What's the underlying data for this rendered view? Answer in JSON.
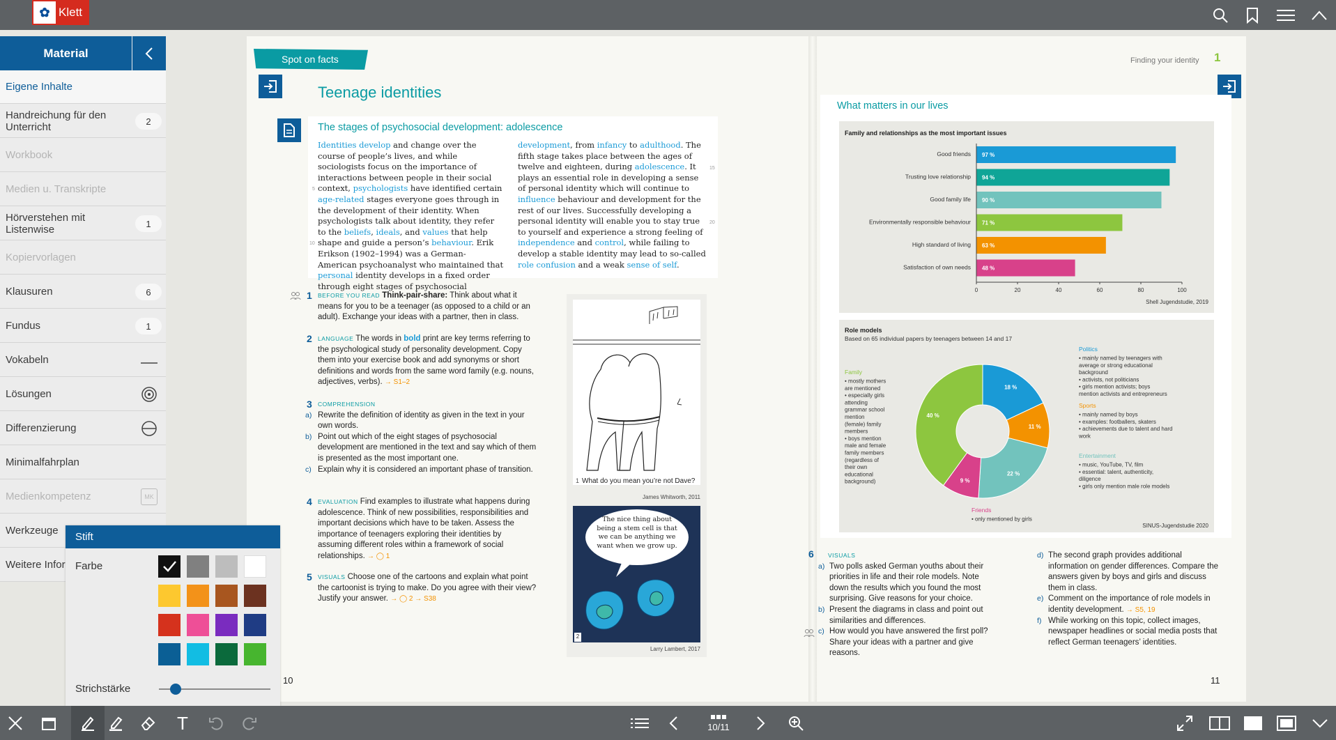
{
  "app": {
    "logo_text": "Klett"
  },
  "sidebar": {
    "title": "Material",
    "items": [
      {
        "label": "Eigene Inhalte",
        "state": "selected"
      },
      {
        "label": "Handreichung für den Unterricht",
        "badge": "2"
      },
      {
        "label": "Workbook",
        "state": "disabled"
      },
      {
        "label": "Medien u. Transkripte",
        "state": "disabled"
      },
      {
        "label": "Hörverstehen mit Listenwise",
        "badge": "1"
      },
      {
        "label": "Kopiervorlagen",
        "state": "disabled"
      },
      {
        "label": "Klausuren",
        "badge": "6"
      },
      {
        "label": "Fundus",
        "badge": "1"
      },
      {
        "label": "Vokabeln",
        "icon": "dash-icon"
      },
      {
        "label": "Lösungen",
        "icon": "target-icon"
      },
      {
        "label": "Differenzierung",
        "icon": "circle-minus-icon"
      },
      {
        "label": "Minimalfahrplan"
      },
      {
        "label": "Medienkompetenz",
        "state": "disabled",
        "icon": "mk-icon",
        "icon_text": "MK"
      },
      {
        "label": "Werkzeuge"
      },
      {
        "label": "Weitere Infor"
      }
    ]
  },
  "pen_panel": {
    "title": "Stift",
    "color_label": "Farbe",
    "stroke_label": "Strichstärke",
    "stroke_level": 0.15,
    "colors": [
      "#111111",
      "#808080",
      "#bdbdbd",
      "#ffffff",
      "#fdc82f",
      "#f39219",
      "#a8561f",
      "#6c3220",
      "#d5321d",
      "#ee4f97",
      "#7a2cbf",
      "#1f3c84",
      "#0b5f95",
      "#12bde3",
      "#0b6a3c",
      "#47b52f"
    ],
    "selected_color_index": 0
  },
  "toolbar": {
    "page_indicator": "10/11"
  },
  "left_page": {
    "banner": "Spot on facts",
    "title": "Teenage identities",
    "box_title": "The stages of psychosocial development: adolescence",
    "col1": [
      {
        "t": "Identities develop",
        "c": "bl"
      },
      {
        "t": " and change over the course of people’s lives, and while sociologists focus on the importance of interactions between people in their social context, "
      },
      {
        "t": "psychologists",
        "c": "bl"
      },
      {
        "t": " have identified certain "
      },
      {
        "t": "age-related",
        "c": "bl"
      },
      {
        "t": " stages everyone goes through in the development of their identity. When psychologists talk about identity, they refer to the "
      },
      {
        "t": "beliefs",
        "c": "bl"
      },
      {
        "t": ", "
      },
      {
        "t": "ideals",
        "c": "bl"
      },
      {
        "t": ", and "
      },
      {
        "t": "values",
        "c": "bl"
      },
      {
        "t": " that help shape and guide a person’s "
      },
      {
        "t": "behaviour",
        "c": "bl"
      },
      {
        "t": ". Erik Erikson (1902–1994) was a German-American psychoanalyst who maintained that "
      },
      {
        "t": "personal",
        "c": "bl"
      },
      {
        "t": " identity develops in a fixed order through eight stages of psychosocial"
      }
    ],
    "col2": [
      {
        "t": "development",
        "c": "bl"
      },
      {
        "t": ", from "
      },
      {
        "t": "infancy",
        "c": "bl"
      },
      {
        "t": " to "
      },
      {
        "t": "adulthood",
        "c": "bl"
      },
      {
        "t": ". The fifth stage takes place between the ages of twelve and eighteen, during "
      },
      {
        "t": "adolescence",
        "c": "bl"
      },
      {
        "t": ". It plays an essential role in developing a sense of personal identity which will continue to "
      },
      {
        "t": "influence",
        "c": "bl"
      },
      {
        "t": " behaviour and development for the rest of our lives. Successfully developing a personal identity will enable you to stay true to yourself and experience a strong feeling of "
      },
      {
        "t": "independence",
        "c": "bl"
      },
      {
        "t": " and "
      },
      {
        "t": "control",
        "c": "bl"
      },
      {
        "t": ", while failing to develop a stable identity may lead to so-called "
      },
      {
        "t": "role confusion",
        "c": "bl"
      },
      {
        "t": " and a weak "
      },
      {
        "t": "sense of self",
        "c": "bl"
      },
      {
        "t": "."
      }
    ],
    "line_numbers": {
      "n5": "5",
      "n10": "10",
      "n15": "15",
      "n20": "20"
    },
    "tasks": [
      {
        "num": "1",
        "label": "BEFORE YOU READ",
        "lead": "Think-pair-share:",
        "text": " Think about what it means for you to be a teenager (as opposed to a child or an adult). Exchange your ideas with a partner, then in class."
      },
      {
        "num": "2",
        "label": "LANGUAGE",
        "text": " The words in ",
        "bold": "bold",
        "text2": " print are key terms referring to the psychological study of personality development. Copy them into your exercise book and add synonyms or short definitions and words from the same word family (e.g. nouns, adjectives, verbs). ",
        "ref": "→ S1–2"
      },
      {
        "num": "3",
        "label": "COMPREHENSION",
        "subs": [
          {
            "l": "a)",
            "t": "Rewrite the definition of identity as given in the text in your own words."
          },
          {
            "l": "b)",
            "t": "Point out which of the eight stages of psychosocial development are mentioned in the text and say which of them is presented as the most important one."
          },
          {
            "l": "c)",
            "t": "Explain why it is considered an important phase of transition."
          }
        ]
      },
      {
        "num": "4",
        "label": "EVALUATION",
        "text": " Find examples to illustrate what happens during adolescence. Think of new possibilities, responsibilities and important decisions which have to be taken. Assess the importance of teenagers exploring their identities by assuming different roles within a framework of social relationships. ",
        "ref": "→ ◯ 1"
      },
      {
        "num": "5",
        "label": "VISUALS",
        "text": " Choose one of the cartoons and explain what point the cartoonist is trying to make. Do you agree with their view? Justify your answer. ",
        "ref": "→ ◯ 2  → S38"
      }
    ],
    "cartoon1": {
      "num": "1",
      "caption": "What do you mean you’re not Dave?",
      "credit": "James Whitworth, 2011"
    },
    "cartoon2": {
      "num": "2",
      "bubble": "The nice thing about being a stem cell is that we can be anything we want when we grow up.",
      "credit": "Larry Lambert, 2017"
    },
    "page_number": "10"
  },
  "right_page": {
    "header": "Finding your identity",
    "chapter": "1",
    "title": "What matters in our lives",
    "task6": {
      "num": "6",
      "label": "VISUALS",
      "subs": [
        {
          "l": "a)",
          "t": "Two polls asked German youths about their priorities in life and their role models. Note down the results which you found the most surprising. Give reasons for your choice."
        },
        {
          "l": "b)",
          "t": "Present the diagrams in class and point out similarities and differences."
        },
        {
          "l": "c)",
          "t": "How would you have answered the first poll? Share your ideas with a partner and give reasons."
        },
        {
          "l": "d)",
          "t": "The second graph provides additional information on gender differences. Compare the answers given by boys and girls and discuss them in class."
        },
        {
          "l": "e)",
          "t": "Comment on the importance of role models in identity development. ",
          "ref": "→ S5, 19"
        },
        {
          "l": "f)",
          "t": "While working on this topic, collect images, newspaper headlines or social media posts that reflect German teenagers’ identities."
        }
      ]
    },
    "page_number": "11"
  },
  "chart_data": [
    {
      "type": "bar",
      "orientation": "horizontal",
      "title": "Family and relationships as the most important issues",
      "categories": [
        "Good friends",
        "Trusting love relationship",
        "Good family life",
        "Environmentally responsible behaviour",
        "High standard of living",
        "Satisfaction of own needs"
      ],
      "values": [
        97,
        94,
        90,
        71,
        63,
        48
      ],
      "value_labels": [
        "97 %",
        "94 %",
        "90 %",
        "71 %",
        "63 %",
        "48 %"
      ],
      "colors": [
        "#1a9ad6",
        "#0fa597",
        "#72c3bd",
        "#8dc63f",
        "#f39200",
        "#d8418a"
      ],
      "xlim": [
        0,
        100
      ],
      "xticks": [
        "0",
        "20",
        "40",
        "60",
        "80",
        "100"
      ],
      "source": "Shell Jugendstudie, 2019"
    },
    {
      "type": "pie",
      "donut": true,
      "title": "Role models",
      "subtitle": "Based on 65 individual papers by teenagers between 14 and 17",
      "slices": [
        {
          "name": "Politics",
          "value": 18,
          "label": "18 %",
          "color": "#1a9ad6",
          "notes": [
            "mainly named by teenagers with average or strong educational background",
            "activists, not politicians",
            "girls mention activists; boys mention activists and entrepreneurs"
          ]
        },
        {
          "name": "Sports",
          "value": 11,
          "label": "11 %",
          "color": "#f39200",
          "notes": [
            "mainly named by boys",
            "examples: footballers, skaters",
            "achievements due to talent and hard work"
          ]
        },
        {
          "name": "Entertainment",
          "value": 22,
          "label": "22 %",
          "color": "#72c3bd",
          "notes": [
            "music, YouTube, TV, film",
            "essential: talent, authenticity, diligence",
            "girls only mention male role models"
          ]
        },
        {
          "name": "Friends",
          "value": 9,
          "label": "9 %",
          "color": "#d8418a",
          "notes": [
            "only mentioned by girls"
          ]
        },
        {
          "name": "Family",
          "value": 40,
          "label": "40 %",
          "color": "#8dc63f",
          "notes": [
            "mostly mothers are mentioned",
            "especially girls attending grammar school mention (female) family members",
            "boys mention male and female family members (regardless of their own educational background)"
          ]
        }
      ],
      "source": "SINUS-Jugendstudie 2020"
    }
  ]
}
